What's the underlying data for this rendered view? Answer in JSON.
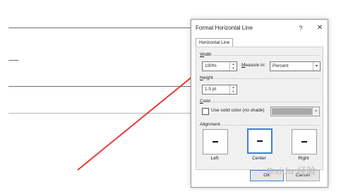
{
  "document": {
    "lines": [
      "line-1",
      "line-2-short",
      "line-3",
      "line-4"
    ]
  },
  "dialog": {
    "title": "Format Horizontal Line",
    "help_label": "?",
    "close_label": "✕",
    "tab_label": "Horizontal Line",
    "width": {
      "label": "Width",
      "value": "100%",
      "measure_label": "Measure in:",
      "measure_value": "Percent"
    },
    "height": {
      "label": "Height",
      "value": "1.5 pt"
    },
    "color": {
      "label": "Color",
      "checkbox_label": "Use solid color (no shade)",
      "checked": false,
      "swatch_color": "#a9a9a9"
    },
    "alignment": {
      "label": "Alignment",
      "options": [
        "Left",
        "Center",
        "Right"
      ],
      "selected": "Center"
    },
    "buttons": {
      "ok": "OK",
      "cancel": "Cancel"
    }
  },
  "annotation": {
    "arrow_color": "#e53935"
  },
  "watermark": {
    "text": "Baidu 经验"
  }
}
